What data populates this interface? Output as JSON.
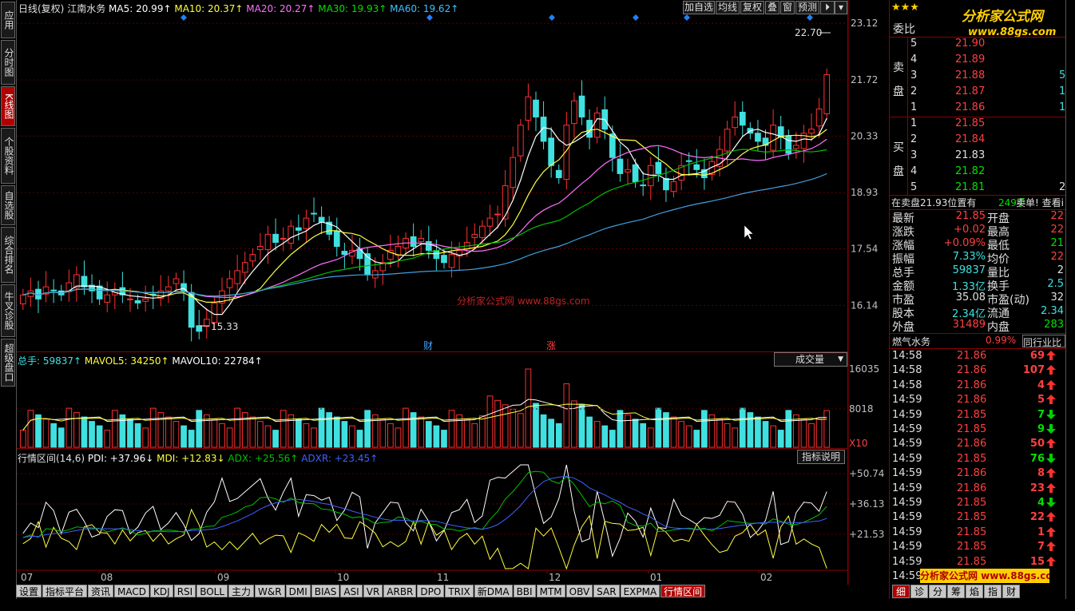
{
  "top_info": {
    "period": "日线(复权)",
    "stock_name": "江南水务",
    "ma5": "MA5: 20.99↑",
    "ma10": "MA10: 20.37↑",
    "ma20": "MA20: 20.27↑",
    "ma30": "MA30: 19.93↑",
    "ma60": "MA60: 19.62↑"
  },
  "top_buttons": [
    "加自选",
    "均线",
    "复权",
    "叠",
    "窗",
    "预测"
  ],
  "left_nav": [
    "应用",
    "分时图",
    "K线图",
    "个股资料",
    "自选股",
    "综合排名",
    "牛叉诊股",
    "超级盘口"
  ],
  "price_axis": [
    "23.12",
    "21.72",
    "20.33",
    "18.93",
    "17.54",
    "16.14"
  ],
  "price_marks": {
    "high": "22.70",
    "low": "15.33"
  },
  "event_marks": [
    "财",
    "涨"
  ],
  "watermark": "分析家公式网 www.88gs.com",
  "volume": {
    "label_total": "总手: 59837↑",
    "label_mavol5": "MAVOL5: 34250↑",
    "label_mavol10": "MAVOL10: 22784↑",
    "dropdown": "成交量",
    "axis": [
      "16035",
      "8018",
      "X10"
    ]
  },
  "indicator": {
    "title": "行情区间(14,6)",
    "pdi": "PDI: +37.96↓",
    "mdi": "MDI: +12.83↓",
    "adx": "ADX: +25.56↑",
    "adxr": "ADXR: +23.45↑",
    "button": "指标说明",
    "axis": [
      "+50.74",
      "+36.13",
      "+21.53"
    ]
  },
  "months": [
    "07",
    "08",
    "09",
    "10",
    "11",
    "12",
    "01",
    "02"
  ],
  "bottom_tabs": [
    "设置",
    "指标平台",
    "资讯",
    "MACD",
    "KDJ",
    "RSI",
    "BOLL",
    "主力",
    "W&R",
    "DMI",
    "BIAS",
    "ASI",
    "VR",
    "ARBR",
    "DPO",
    "TRIX",
    "新DMA",
    "BBI",
    "MTM",
    "OBV",
    "SAR",
    "EXPMA",
    "行情区间"
  ],
  "right_panel": {
    "logo_text": "分析家公式网",
    "logo_url": "www.88gs.com",
    "weibi_label": "委比",
    "sell_label": "卖盘",
    "buy_label": "买盘",
    "sell": [
      {
        "lvl": "5",
        "price": "21.90"
      },
      {
        "lvl": "4",
        "price": "21.89"
      },
      {
        "lvl": "3",
        "price": "21.88",
        "vol": "5"
      },
      {
        "lvl": "2",
        "price": "21.87",
        "vol": "1"
      },
      {
        "lvl": "1",
        "price": "21.86",
        "vol": "1"
      }
    ],
    "buy": [
      {
        "lvl": "1",
        "price": "21.85"
      },
      {
        "lvl": "2",
        "price": "21.84"
      },
      {
        "lvl": "3",
        "price": "21.83"
      },
      {
        "lvl": "4",
        "price": "21.82"
      },
      {
        "lvl": "5",
        "price": "21.81",
        "vol": "2"
      }
    ],
    "notice": {
      "text": "在卖盘21.93位置有",
      "vol": "249手",
      "tail": "卖单! 查看i"
    },
    "stats": [
      {
        "l1": "最新",
        "v1": "21.85",
        "l2": "开盘",
        "v2": "22"
      },
      {
        "l1": "涨跌",
        "v1": "+0.02",
        "l2": "最高",
        "v2": "22"
      },
      {
        "l1": "涨幅",
        "v1": "+0.09%",
        "l2": "最低",
        "v2": "21"
      },
      {
        "l1": "振幅",
        "v1": "7.33%",
        "l2": "均价",
        "v2": "22"
      },
      {
        "l1": "总手",
        "v1": "59837",
        "l2": "量比",
        "v2": "2"
      },
      {
        "l1": "金额",
        "v1": "1.33亿",
        "l2": "换手",
        "v2": "2.5"
      },
      {
        "l1": "市盈",
        "v1": "35.08",
        "l2": "市盈(动)",
        "v2": "32"
      },
      {
        "l1": "股本",
        "v1": "2.34亿",
        "l2": "流通",
        "v2": "2.34"
      },
      {
        "l1": "外盘",
        "v1": "31489",
        "l2": "内盘",
        "v2": "283"
      }
    ],
    "sector": {
      "name": "燃气水务",
      "pct": "0.99%",
      "btn": "同行业比"
    },
    "ticks": [
      {
        "t": "14:58",
        "p": "21.86",
        "v": "69",
        "d": "up"
      },
      {
        "t": "14:58",
        "p": "21.86",
        "v": "107",
        "d": "up"
      },
      {
        "t": "14:58",
        "p": "21.86",
        "v": "4",
        "d": "up"
      },
      {
        "t": "14:59",
        "p": "21.86",
        "v": "5",
        "d": "up"
      },
      {
        "t": "14:59",
        "p": "21.85",
        "v": "7",
        "d": "down"
      },
      {
        "t": "14:59",
        "p": "21.85",
        "v": "9",
        "d": "down"
      },
      {
        "t": "14:59",
        "p": "21.86",
        "v": "50",
        "d": "up"
      },
      {
        "t": "14:59",
        "p": "21.85",
        "v": "76",
        "d": "down"
      },
      {
        "t": "14:59",
        "p": "21.86",
        "v": "8",
        "d": "up"
      },
      {
        "t": "14:59",
        "p": "21.86",
        "v": "23",
        "d": "up"
      },
      {
        "t": "14:59",
        "p": "21.85",
        "v": "4",
        "d": "down"
      },
      {
        "t": "14:59",
        "p": "21.85",
        "v": "22",
        "d": "up"
      },
      {
        "t": "14:59",
        "p": "21.85",
        "v": "1",
        "d": "up"
      },
      {
        "t": "14:59",
        "p": "21.85",
        "v": "7",
        "d": "up"
      },
      {
        "t": "14:59",
        "p": "21.85",
        "v": "15",
        "d": "up"
      },
      {
        "t": "14:59",
        "p": "",
        "v": "",
        "d": ""
      }
    ],
    "tabs": [
      "细",
      "诊",
      "分",
      "筹",
      "焰",
      "指",
      "财"
    ],
    "footer_logo": "分析家公式网 www.88gs.com"
  },
  "colors": {
    "up": "#ff3030",
    "down": "#40e0e0",
    "ma5": "#ffffff",
    "ma10": "#ffff40",
    "ma20": "#ff70ff",
    "ma30": "#00c000",
    "ma60": "#40a0e0",
    "grid": "#8b0000"
  },
  "chart_data": {
    "type": "candlestick",
    "closes": [
      16.4,
      16.5,
      16.3,
      16.6,
      16.5,
      16.4,
      16.7,
      16.9,
      16.6,
      16.5,
      16.3,
      16.4,
      16.5,
      16.4,
      16.3,
      16.2,
      16.3,
      16.4,
      16.5,
      16.6,
      16.8,
      16.5,
      15.6,
      15.5,
      15.8,
      16.2,
      16.5,
      16.8,
      17.0,
      17.2,
      17.4,
      17.6,
      17.9,
      17.7,
      17.8,
      18.1,
      18.0,
      18.3,
      18.4,
      18.2,
      17.9,
      17.6,
      17.4,
      17.5,
      17.3,
      16.9,
      17.0,
      17.2,
      17.5,
      17.6,
      17.8,
      17.6,
      17.8,
      17.5,
      17.3,
      17.2,
      17.4,
      17.5,
      17.7,
      17.9,
      18.1,
      18.3,
      18.4,
      19.1,
      19.8,
      20.6,
      21.3,
      20.8,
      20.2,
      19.6,
      19.3,
      20.6,
      21.2,
      20.8,
      20.3,
      20.9,
      20.5,
      19.8,
      19.4,
      19.5,
      19.2,
      19.1,
      19.6,
      19.4,
      19.0,
      19.2,
      19.6,
      19.7,
      19.5,
      19.3,
      19.7,
      20.0,
      20.5,
      20.8,
      20.6,
      20.4,
      20.2,
      20.1,
      20.6,
      20.3,
      19.9,
      20.1,
      20.4,
      20.5,
      21.0,
      21.85
    ]
  }
}
